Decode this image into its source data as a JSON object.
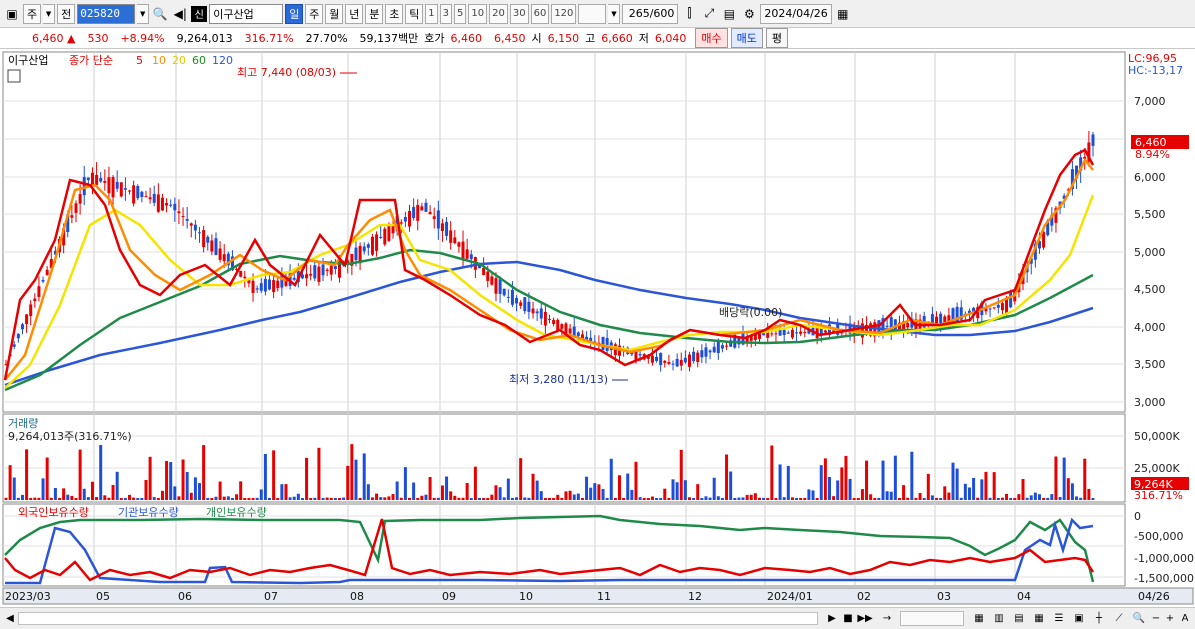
{
  "toolbar": {
    "market": "주",
    "prev_label": "전",
    "code": "025820",
    "name_badge": "신",
    "name": "이구산업",
    "periods": [
      "일",
      "주",
      "월",
      "년",
      "분",
      "초",
      "틱"
    ],
    "active_period": "일",
    "intervals": [
      "1",
      "3",
      "5",
      "10",
      "20",
      "30",
      "60",
      "120"
    ],
    "count": "265",
    "count_total": "/600",
    "date": "2024/04/26"
  },
  "quote": {
    "price": "6,460",
    "change_arrow": "▲",
    "change": "530",
    "change_pct": "+8.94%",
    "volume": "9,264,013",
    "volume_ratio": "316.71%",
    "turnover": "27.70%",
    "amount": "59,137백만",
    "ask_label": "호가",
    "ask": "6,460",
    "bid": "6,450",
    "open_label": "시",
    "open": "6,150",
    "high_label": "고",
    "high": "6,660",
    "low_label": "저",
    "low": "6,040",
    "buy_label": "매수",
    "sell_label": "매도",
    "avg_label": "평"
  },
  "price_panel": {
    "stock_label": "이구산업",
    "ma_title": "종가 단순",
    "ma_periods": [
      "5",
      "10",
      "20",
      "60",
      "120"
    ],
    "ma_colors": [
      "#e60000",
      "#ff8c00",
      "#f5e400",
      "#1f8a1f",
      "#2b56d6"
    ],
    "lc_label": "LC:96,95",
    "hc_label": "HC:-13,17",
    "high_annotation": "최고 7,440 (08/03)",
    "low_annotation": "최저 3,280 (11/13)",
    "dividend_annotation": "배당락(0.00)",
    "y_ticks": [
      "7,000",
      "6,500",
      "6,000",
      "5,500",
      "5,000",
      "4,500",
      "4,000",
      "3,500",
      "3,000"
    ],
    "last_price_tag": "6,460",
    "last_change_tag": "8.94%"
  },
  "volume_panel": {
    "title": "거래량",
    "value": "9,264,013주(316.71%)",
    "y_ticks": [
      "50,000K",
      "25,000K"
    ],
    "last_tag": "9,264K",
    "last_ratio_tag": "316.71%"
  },
  "holdings_panel": {
    "legend": [
      "외국인보유수량",
      "기관보유수량",
      "개인보유수량"
    ],
    "legend_colors": [
      "#e60000",
      "#2b56d6",
      "#1f8a4a"
    ],
    "y_ticks": [
      "0",
      "-500,000",
      "-1,000,000",
      "-1,500,000"
    ]
  },
  "x_axis": {
    "labels": [
      "2023/03",
      "05",
      "06",
      "07",
      "08",
      "09",
      "10",
      "11",
      "12",
      "2024/01",
      "02",
      "03",
      "04"
    ],
    "last_label": "04/26"
  },
  "chart_data": {
    "type": "line",
    "title": "이구산업",
    "ylim": [
      2950,
      7700
    ],
    "price_close_approx": [
      {
        "date": "2023/03",
        "close": 3500
      },
      {
        "date": "2023/04-mid",
        "close": 6000
      },
      {
        "date": "2023/05",
        "close": 5600
      },
      {
        "date": "2023/06",
        "close": 4500
      },
      {
        "date": "2023/07",
        "close": 4800
      },
      {
        "date": "2023/08",
        "close": 5600
      },
      {
        "date": "2023/09",
        "close": 4400
      },
      {
        "date": "2023/10",
        "close": 3800
      },
      {
        "date": "2023/11",
        "close": 3500
      },
      {
        "date": "2023/12",
        "close": 3900
      },
      {
        "date": "2024/01",
        "close": 3950
      },
      {
        "date": "2024/02",
        "close": 4050
      },
      {
        "date": "2024/03",
        "close": 4300
      },
      {
        "date": "2024/04/26",
        "close": 6460
      }
    ],
    "highest": {
      "value": 7440,
      "date": "08/03"
    },
    "lowest": {
      "value": 3280,
      "date": "11/13"
    }
  }
}
